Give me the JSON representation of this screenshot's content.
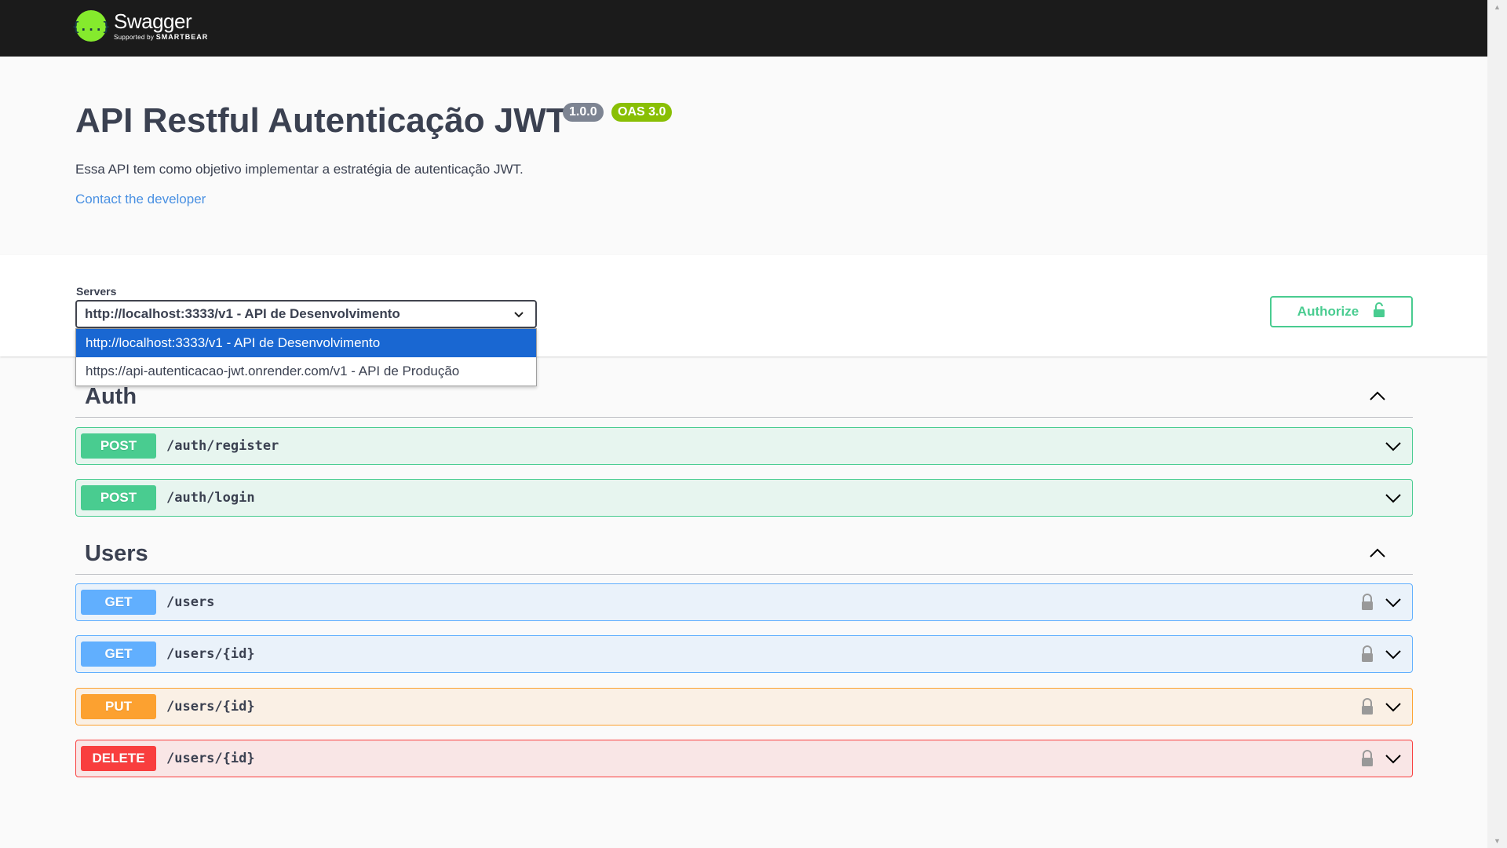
{
  "topbar": {
    "logo_name": "Swagger",
    "logo_sub_prefix": "Supported by",
    "logo_sub_brand": "SMARTBEAR",
    "logo_glyph": "{...}"
  },
  "info": {
    "title": "API Restful Autenticação JWT",
    "version": "1.0.0",
    "oas": "OAS 3.0",
    "description": "Essa API tem como objetivo implementar a estratégia de autenticação JWT.",
    "contact": "Contact the developer"
  },
  "servers": {
    "label": "Servers",
    "selected": "http://localhost:3333/v1 - API de Desenvolvimento",
    "options": [
      "http://localhost:3333/v1 - API de Desenvolvimento",
      "https://api-autenticacao-jwt.onrender.com/v1 - API de Produção"
    ]
  },
  "authorize": {
    "label": "Authorize"
  },
  "tags": [
    {
      "name": "Auth",
      "operations": [
        {
          "method": "POST",
          "path": "/auth/register",
          "locked": false
        },
        {
          "method": "POST",
          "path": "/auth/login",
          "locked": false
        }
      ]
    },
    {
      "name": "Users",
      "operations": [
        {
          "method": "GET",
          "path": "/users",
          "locked": true
        },
        {
          "method": "GET",
          "path": "/users/{id}",
          "locked": true
        },
        {
          "method": "PUT",
          "path": "/users/{id}",
          "locked": true
        },
        {
          "method": "DELETE",
          "path": "/users/{id}",
          "locked": true
        }
      ]
    }
  ],
  "colors": {
    "post": "#49cc90",
    "get": "#61affe",
    "put": "#fca130",
    "delete": "#f93e3e",
    "topbar": "#1b1b1b",
    "logo": "#85ea2d",
    "link": "#4990e2",
    "dropdown_selected": "#1967d2"
  },
  "icons": {
    "section_toggle": "chevron-up-icon",
    "op_expand": "chevron-down-icon",
    "op_lock": "lock-icon"
  }
}
